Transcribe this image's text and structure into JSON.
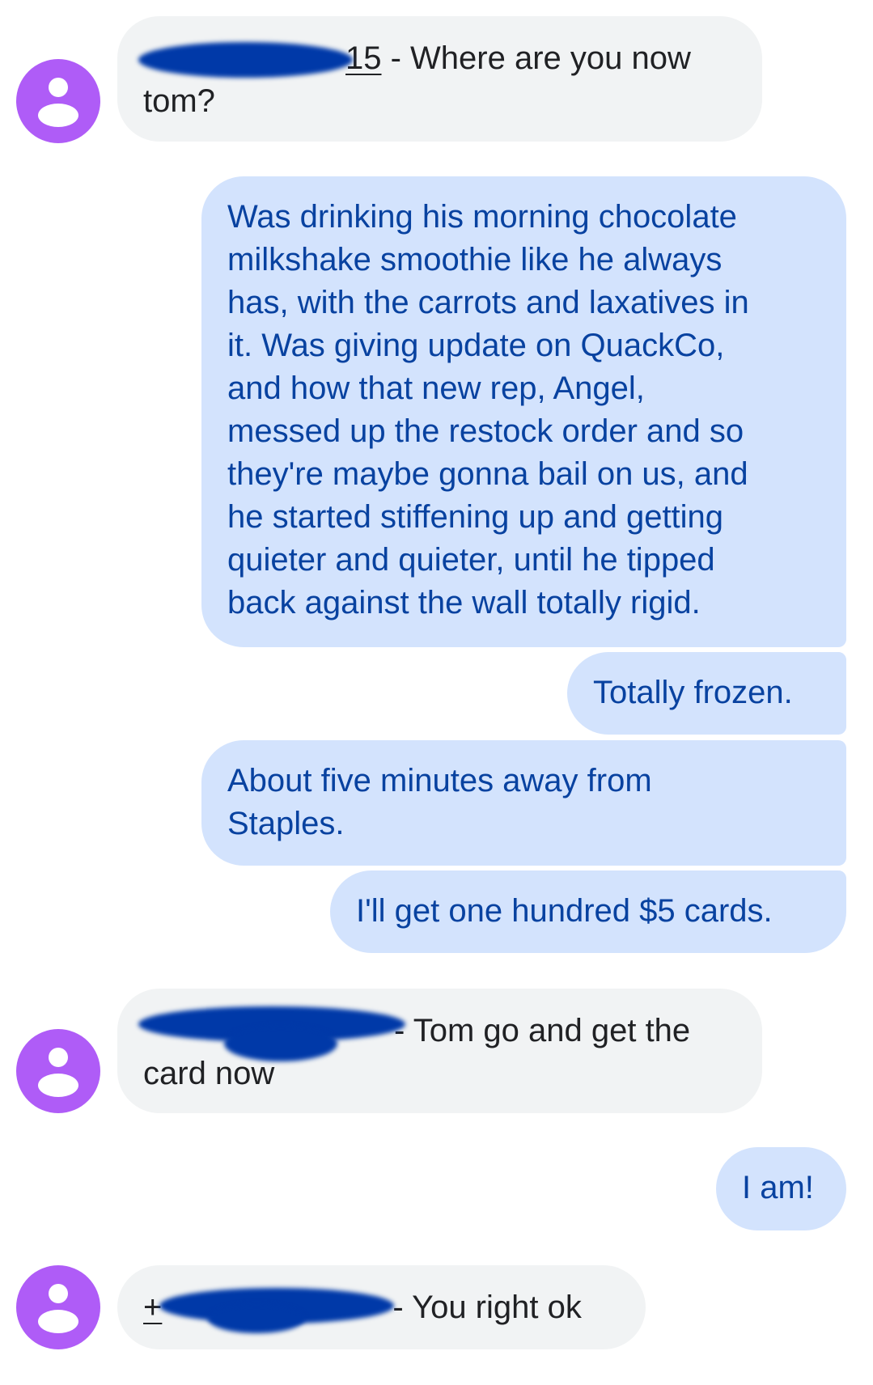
{
  "colors": {
    "incoming_bg": "#f1f3f4",
    "incoming_text": "#202124",
    "outgoing_bg": "#d3e3fd",
    "outgoing_text": "#0842a0",
    "avatar": "#af5cf7",
    "redaction": "#0039a8"
  },
  "messages": [
    {
      "direction": "incoming",
      "sender_visible": "15",
      "line1": " - Where are you now",
      "line2": "tom?"
    },
    {
      "direction": "outgoing",
      "lines": [
        "Was drinking his morning chocolate",
        "milkshake smoothie like he always",
        "has, with the carrots and laxatives in",
        "it.  Was giving update on QuackCo,",
        "and how that new rep, Angel,",
        "messed up the restock order and so",
        "they're maybe gonna bail on us, and",
        "he started stiffening up and getting",
        "quieter and quieter, until he tipped",
        "back against the wall totally rigid."
      ]
    },
    {
      "direction": "outgoing",
      "text": "Totally frozen."
    },
    {
      "direction": "outgoing",
      "lines": [
        "About five minutes away from",
        "Staples."
      ]
    },
    {
      "direction": "outgoing",
      "text": "I'll get one hundred $5 cards."
    },
    {
      "direction": "incoming",
      "sender_visible": "",
      "line1": "- Tom go and get the",
      "line2": "card now"
    },
    {
      "direction": "outgoing",
      "text": "I am!"
    },
    {
      "direction": "incoming",
      "sender_visible": "+",
      "line1": "- You right ok"
    }
  ]
}
